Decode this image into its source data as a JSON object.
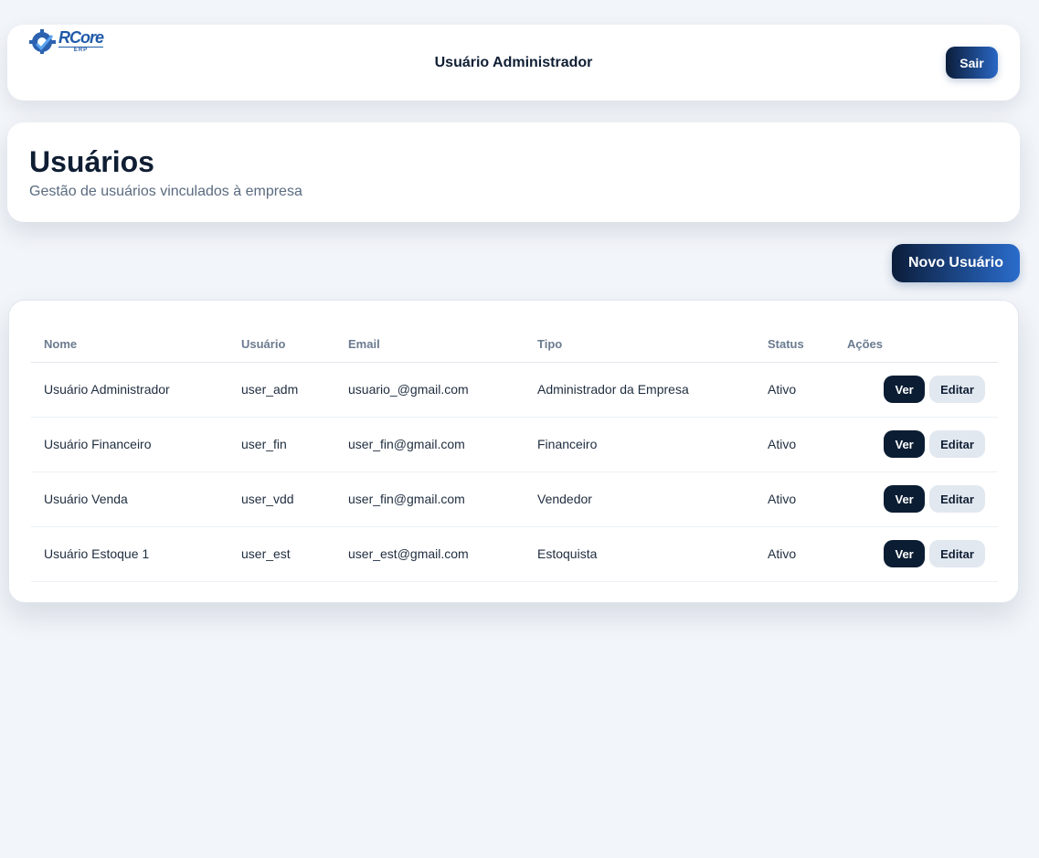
{
  "topbar": {
    "logo_main": "RCore",
    "logo_sub": "ERP",
    "user_name": "Usuário Administrador",
    "logout_label": "Sair"
  },
  "header": {
    "title": "Usuários",
    "subtitle": "Gestão de usuários vinculados à empresa"
  },
  "new_user_label": "Novo Usuário",
  "table": {
    "columns": [
      "Nome",
      "Usuário",
      "Email",
      "Tipo",
      "Status",
      "Ações"
    ],
    "rows": [
      {
        "nome": "Usuário Administrador",
        "usuario": "user_adm",
        "email": "usuario_@gmail.com",
        "tipo": "Administrador da Empresa",
        "status": "Ativo",
        "ver": "Ver",
        "editar": "Editar"
      },
      {
        "nome": "Usuário Financeiro",
        "usuario": "user_fin",
        "email": "user_fin@gmail.com",
        "tipo": "Financeiro",
        "status": "Ativo",
        "ver": "Ver",
        "editar": "Editar"
      },
      {
        "nome": "Usuário Venda",
        "usuario": "user_vdd",
        "email": "user_fin@gmail.com",
        "tipo": "Vendedor",
        "status": "Ativo",
        "ver": "Ver",
        "editar": "Editar"
      },
      {
        "nome": "Usuário Estoque 1",
        "usuario": "user_est",
        "email": "user_est@gmail.com",
        "tipo": "Estoquista",
        "status": "Ativo",
        "ver": "Ver",
        "editar": "Editar"
      }
    ]
  }
}
